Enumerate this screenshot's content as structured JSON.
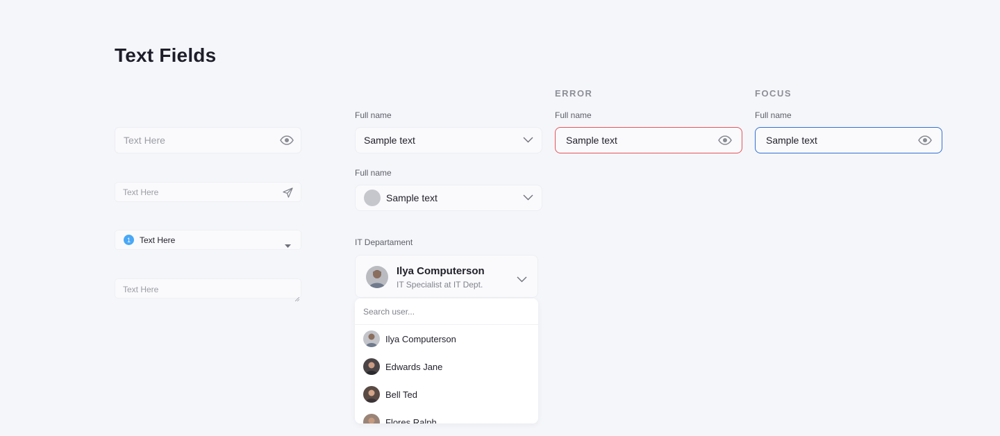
{
  "page_title": "Text Fields",
  "columns": {
    "error": "ERROR",
    "focus": "FOCUS"
  },
  "left_fields": {
    "password": {
      "placeholder": "Text Here",
      "icon": "eye-icon"
    },
    "send": {
      "placeholder": "Text Here",
      "icon": "send-icon"
    },
    "numbered_select": {
      "badge": "1",
      "value": "Text Here",
      "icon": "caret-down-icon"
    },
    "textarea": {
      "placeholder": "Text Here"
    }
  },
  "middle_fields": {
    "select1": {
      "label": "Full name",
      "value": "Sample text",
      "icon": "chevron-down-icon"
    },
    "select2": {
      "label": "Full name",
      "value": "Sample text",
      "icon": "chevron-down-icon"
    },
    "user_select": {
      "label": "IT Departament",
      "name": "Ilya Computerson",
      "role": "IT Specialist at IT Dept.",
      "icon": "chevron-down-icon"
    },
    "dropdown": {
      "search_placeholder": "Search user...",
      "items": [
        "Ilya Computerson",
        "Edwards Jane",
        "Bell Ted",
        "Flores Ralph"
      ]
    }
  },
  "error_field": {
    "label": "Full name",
    "value": "Sample text",
    "icon": "eye-icon",
    "border_color": "#e4545a"
  },
  "focus_field": {
    "label": "Full name",
    "value": "Sample text",
    "icon": "eye-icon",
    "border_color": "#2f6fd1"
  }
}
